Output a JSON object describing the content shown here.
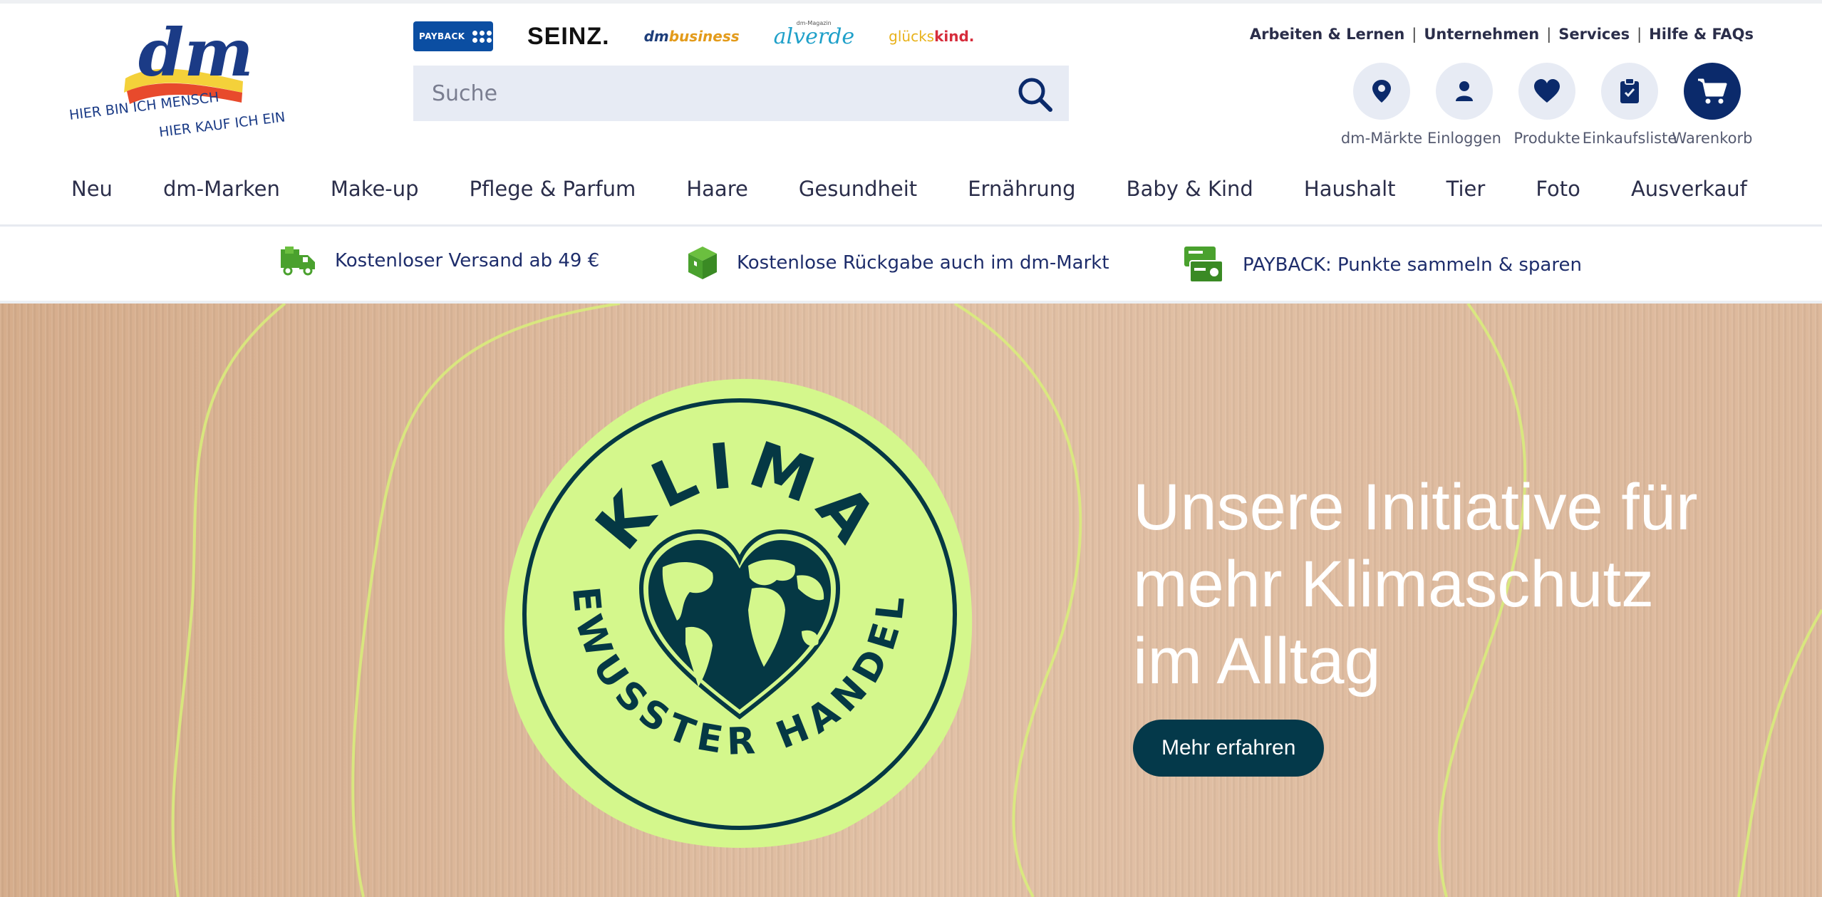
{
  "logo": {
    "brand": "dm",
    "tagline_line1": "HIER BIN ICH MENSCH",
    "tagline_line2": "HIER KAUF ICH EIN"
  },
  "brands": {
    "payback": "PAYBACK",
    "seinz": "SEINZ.",
    "dmbusiness_prefix": "dm",
    "dmbusiness_suffix": "business",
    "alverde_small": "dm-Magazin",
    "alverde": "alverde",
    "glueckskind_prefix": "glücks",
    "glueckskind_suffix": "kind."
  },
  "search": {
    "placeholder": "Suche",
    "icon": "search-icon"
  },
  "util_links": [
    "Arbeiten & Lernen",
    "Unternehmen",
    "Services",
    "Hilfe & FAQs"
  ],
  "actions": [
    {
      "label": "dm-Märkte",
      "icon": "location-pin-icon"
    },
    {
      "label": "Einloggen",
      "icon": "user-icon"
    },
    {
      "label": "Produkte",
      "icon": "heart-icon"
    },
    {
      "label": "Einkaufsliste",
      "icon": "clipboard-check-icon"
    },
    {
      "label": "Warenkorb",
      "icon": "cart-icon"
    }
  ],
  "nav": [
    "Neu",
    "dm-Marken",
    "Make-up",
    "Pflege & Parfum",
    "Haare",
    "Gesundheit",
    "Ernährung",
    "Baby & Kind",
    "Haushalt",
    "Tier",
    "Foto",
    "Ausverkauf"
  ],
  "usp": [
    {
      "text": "Kostenloser Versand ab 49 €",
      "icon": "delivery-truck-icon"
    },
    {
      "text": "Kostenlose Rückgabe auch im dm-Markt",
      "icon": "package-box-icon"
    },
    {
      "text": "PAYBACK: Punkte sammeln & sparen",
      "icon": "payback-cards-icon"
    }
  ],
  "hero": {
    "badge_top": "KLIMA",
    "badge_bottom": "BEWUSSTER HANDELN",
    "title_line1": "Unsere Initiative für",
    "title_line2": "mehr Klimaschutz",
    "title_line3": "im Alltag",
    "button": "Mehr erfahren"
  },
  "colors": {
    "navy": "#0b2a6b",
    "search_bg": "#e7ebf4",
    "usp_green": "#4aa12e",
    "hero_bg": "#d9b497",
    "badge_green": "#d4f78c",
    "badge_dark": "#053844",
    "button_bg": "#04394a"
  }
}
